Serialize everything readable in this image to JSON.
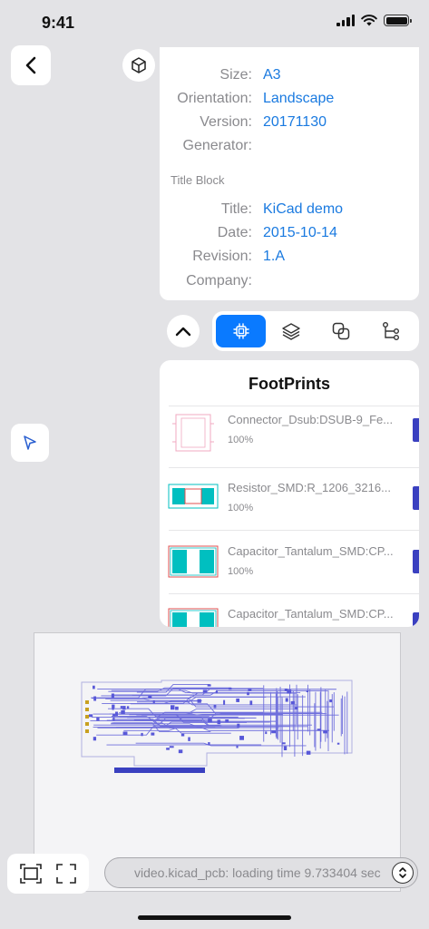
{
  "status_bar": {
    "time": "9:41"
  },
  "info": {
    "rows": [
      {
        "label": "Size:",
        "value": "A3"
      },
      {
        "label": "Orientation:",
        "value": "Landscape"
      },
      {
        "label": "Version:",
        "value": "20171130"
      },
      {
        "label": "Generator:",
        "value": ""
      }
    ],
    "title_block_heading": "Title Block",
    "title_block_rows": [
      {
        "label": "Title:",
        "value": "KiCad demo"
      },
      {
        "label": "Date:",
        "value": "2015-10-14"
      },
      {
        "label": "Revision:",
        "value": "1.A"
      },
      {
        "label": "Company:",
        "value": ""
      }
    ]
  },
  "toolbar": {
    "tabs": [
      {
        "icon": "chip-icon",
        "active": true
      },
      {
        "icon": "layers-icon",
        "active": false
      },
      {
        "icon": "overlap-squares-icon",
        "active": false
      },
      {
        "icon": "net-tree-icon",
        "active": false
      }
    ]
  },
  "footprints": {
    "title": "FootPrints",
    "items": [
      {
        "name": "Connector_Dsub:DSUB-9_Fe...",
        "percent": "100%"
      },
      {
        "name": "Resistor_SMD:R_1206_3216...",
        "percent": "100%"
      },
      {
        "name": "Capacitor_Tantalum_SMD:CP...",
        "percent": "100%"
      },
      {
        "name": "Capacitor_Tantalum_SMD:CP...",
        "percent": ""
      }
    ]
  },
  "log": {
    "text": "video.kicad_pcb: loading time 9.733404 sec"
  },
  "colors": {
    "accent": "#0a7aff",
    "link": "#1a7ae0",
    "pad_teal": "#00bfc0",
    "pcb_trace": "#5858d8",
    "progress_bar": "#3a40c0"
  }
}
